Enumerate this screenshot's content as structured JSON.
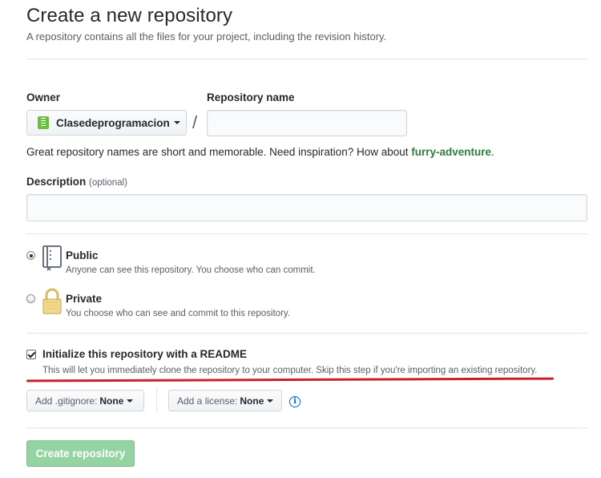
{
  "header": {
    "title": "Create a new repository",
    "subtitle": "A repository contains all the files for your project, including the revision history."
  },
  "owner": {
    "label": "Owner",
    "value": "Clasedeprogramacion",
    "avatar_icon": "organization-avatar-icon"
  },
  "separator": "/",
  "repo_name": {
    "label": "Repository name",
    "value": "",
    "placeholder": ""
  },
  "hint": {
    "text": "Great repository names are short and memorable. Need inspiration? How about ",
    "suggestion": "furry-adventure",
    "suffix": "."
  },
  "description": {
    "label": "Description",
    "optional": "(optional)",
    "value": "",
    "placeholder": ""
  },
  "visibility": {
    "selected": "public",
    "public": {
      "title": "Public",
      "note": "Anyone can see this repository. You choose who can commit.",
      "icon": "repo-book-icon"
    },
    "private": {
      "title": "Private",
      "note": "You choose who can see and commit to this repository.",
      "icon": "lock-icon"
    }
  },
  "readme": {
    "checked": true,
    "label": "Initialize this repository with a README",
    "note": "This will let you immediately clone the repository to your computer. Skip this step if you're importing an existing repository."
  },
  "gitignore": {
    "label": "Add .gitignore:",
    "value": "None"
  },
  "license": {
    "label": "Add a license:",
    "value": "None",
    "info_icon": "info-icon"
  },
  "create_button": "Create repository",
  "colors": {
    "suggestion": "#2b7f3a",
    "create_button_bg": "#94d3a2",
    "annotation_line": "#cc1f2d",
    "info_icon": "#0366d6"
  }
}
